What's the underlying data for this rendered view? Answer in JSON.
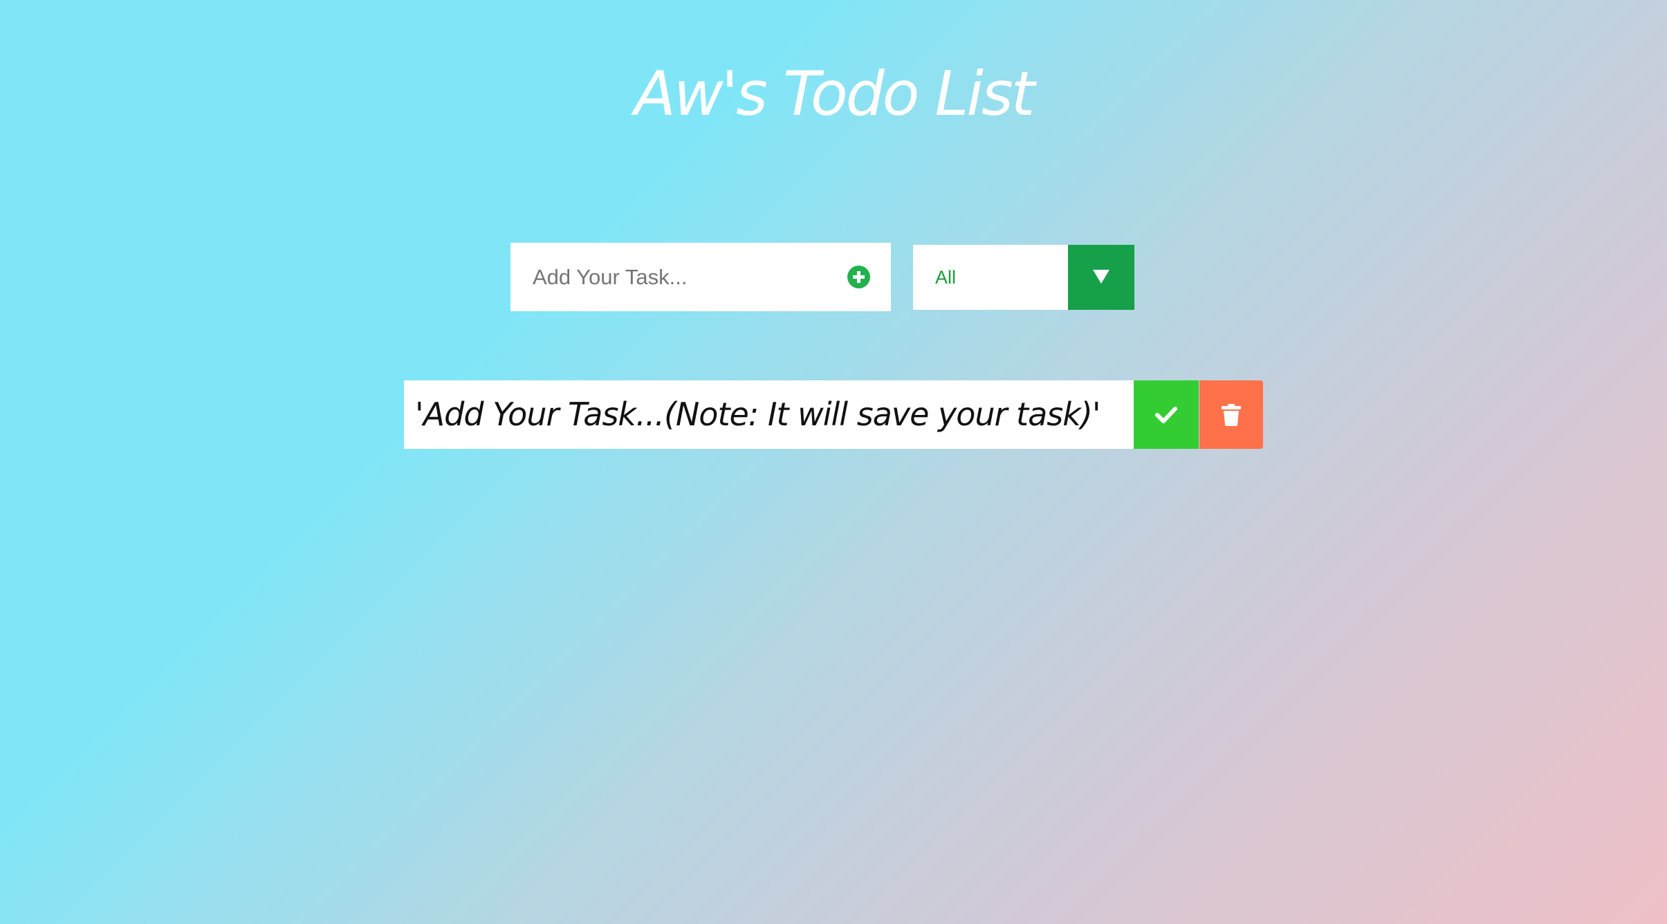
{
  "header": {
    "title": "Aw's Todo List"
  },
  "task_form": {
    "placeholder": "Add Your Task...",
    "value": "",
    "add_icon": "plus-circle-icon"
  },
  "filter": {
    "selected": "All",
    "arrow_icon": "triangle-down-icon"
  },
  "todos": [
    {
      "text": "'Add Your Task...(Note: It will save your task)'",
      "complete_icon": "check-icon",
      "delete_icon": "trash-icon"
    }
  ],
  "colors": {
    "complete": "#33cd33",
    "delete": "#ff714a",
    "filter_accent": "#17a04a",
    "add_accent": "#22b14c",
    "bg_start": "#80e6f7",
    "bg_end": "#efc1c7"
  }
}
